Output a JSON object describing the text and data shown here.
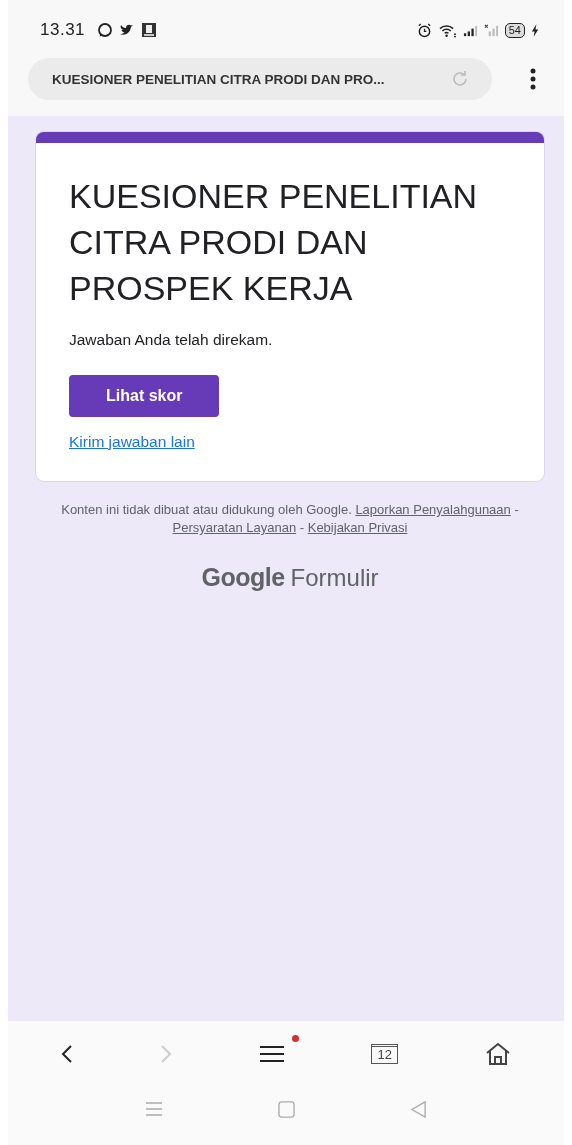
{
  "status_bar": {
    "time": "13.31",
    "battery": "54"
  },
  "browser": {
    "address": "KUESIONER PENELITIAN CITRA PRODI DAN PRO..."
  },
  "form": {
    "title": "KUESIONER PENELITIAN CITRA PRODI DAN PROSPEK KERJA",
    "message": "Jawaban Anda telah direkam.",
    "score_button": "Lihat skor",
    "another_link": "Kirim jawaban lain"
  },
  "footer": {
    "text": "Konten ini tidak dibuat atau didukung oleh Google.",
    "links": [
      "Laporkan Penyalahgunaan",
      "Persyaratan Layanan",
      "Kebijakan Privasi"
    ],
    "separator": "-",
    "brand_word": "Google",
    "product": "Formulir"
  },
  "bottom_nav": {
    "back_disabled": false,
    "forward_disabled": true,
    "menu_notification": true,
    "tab_count": "12"
  }
}
